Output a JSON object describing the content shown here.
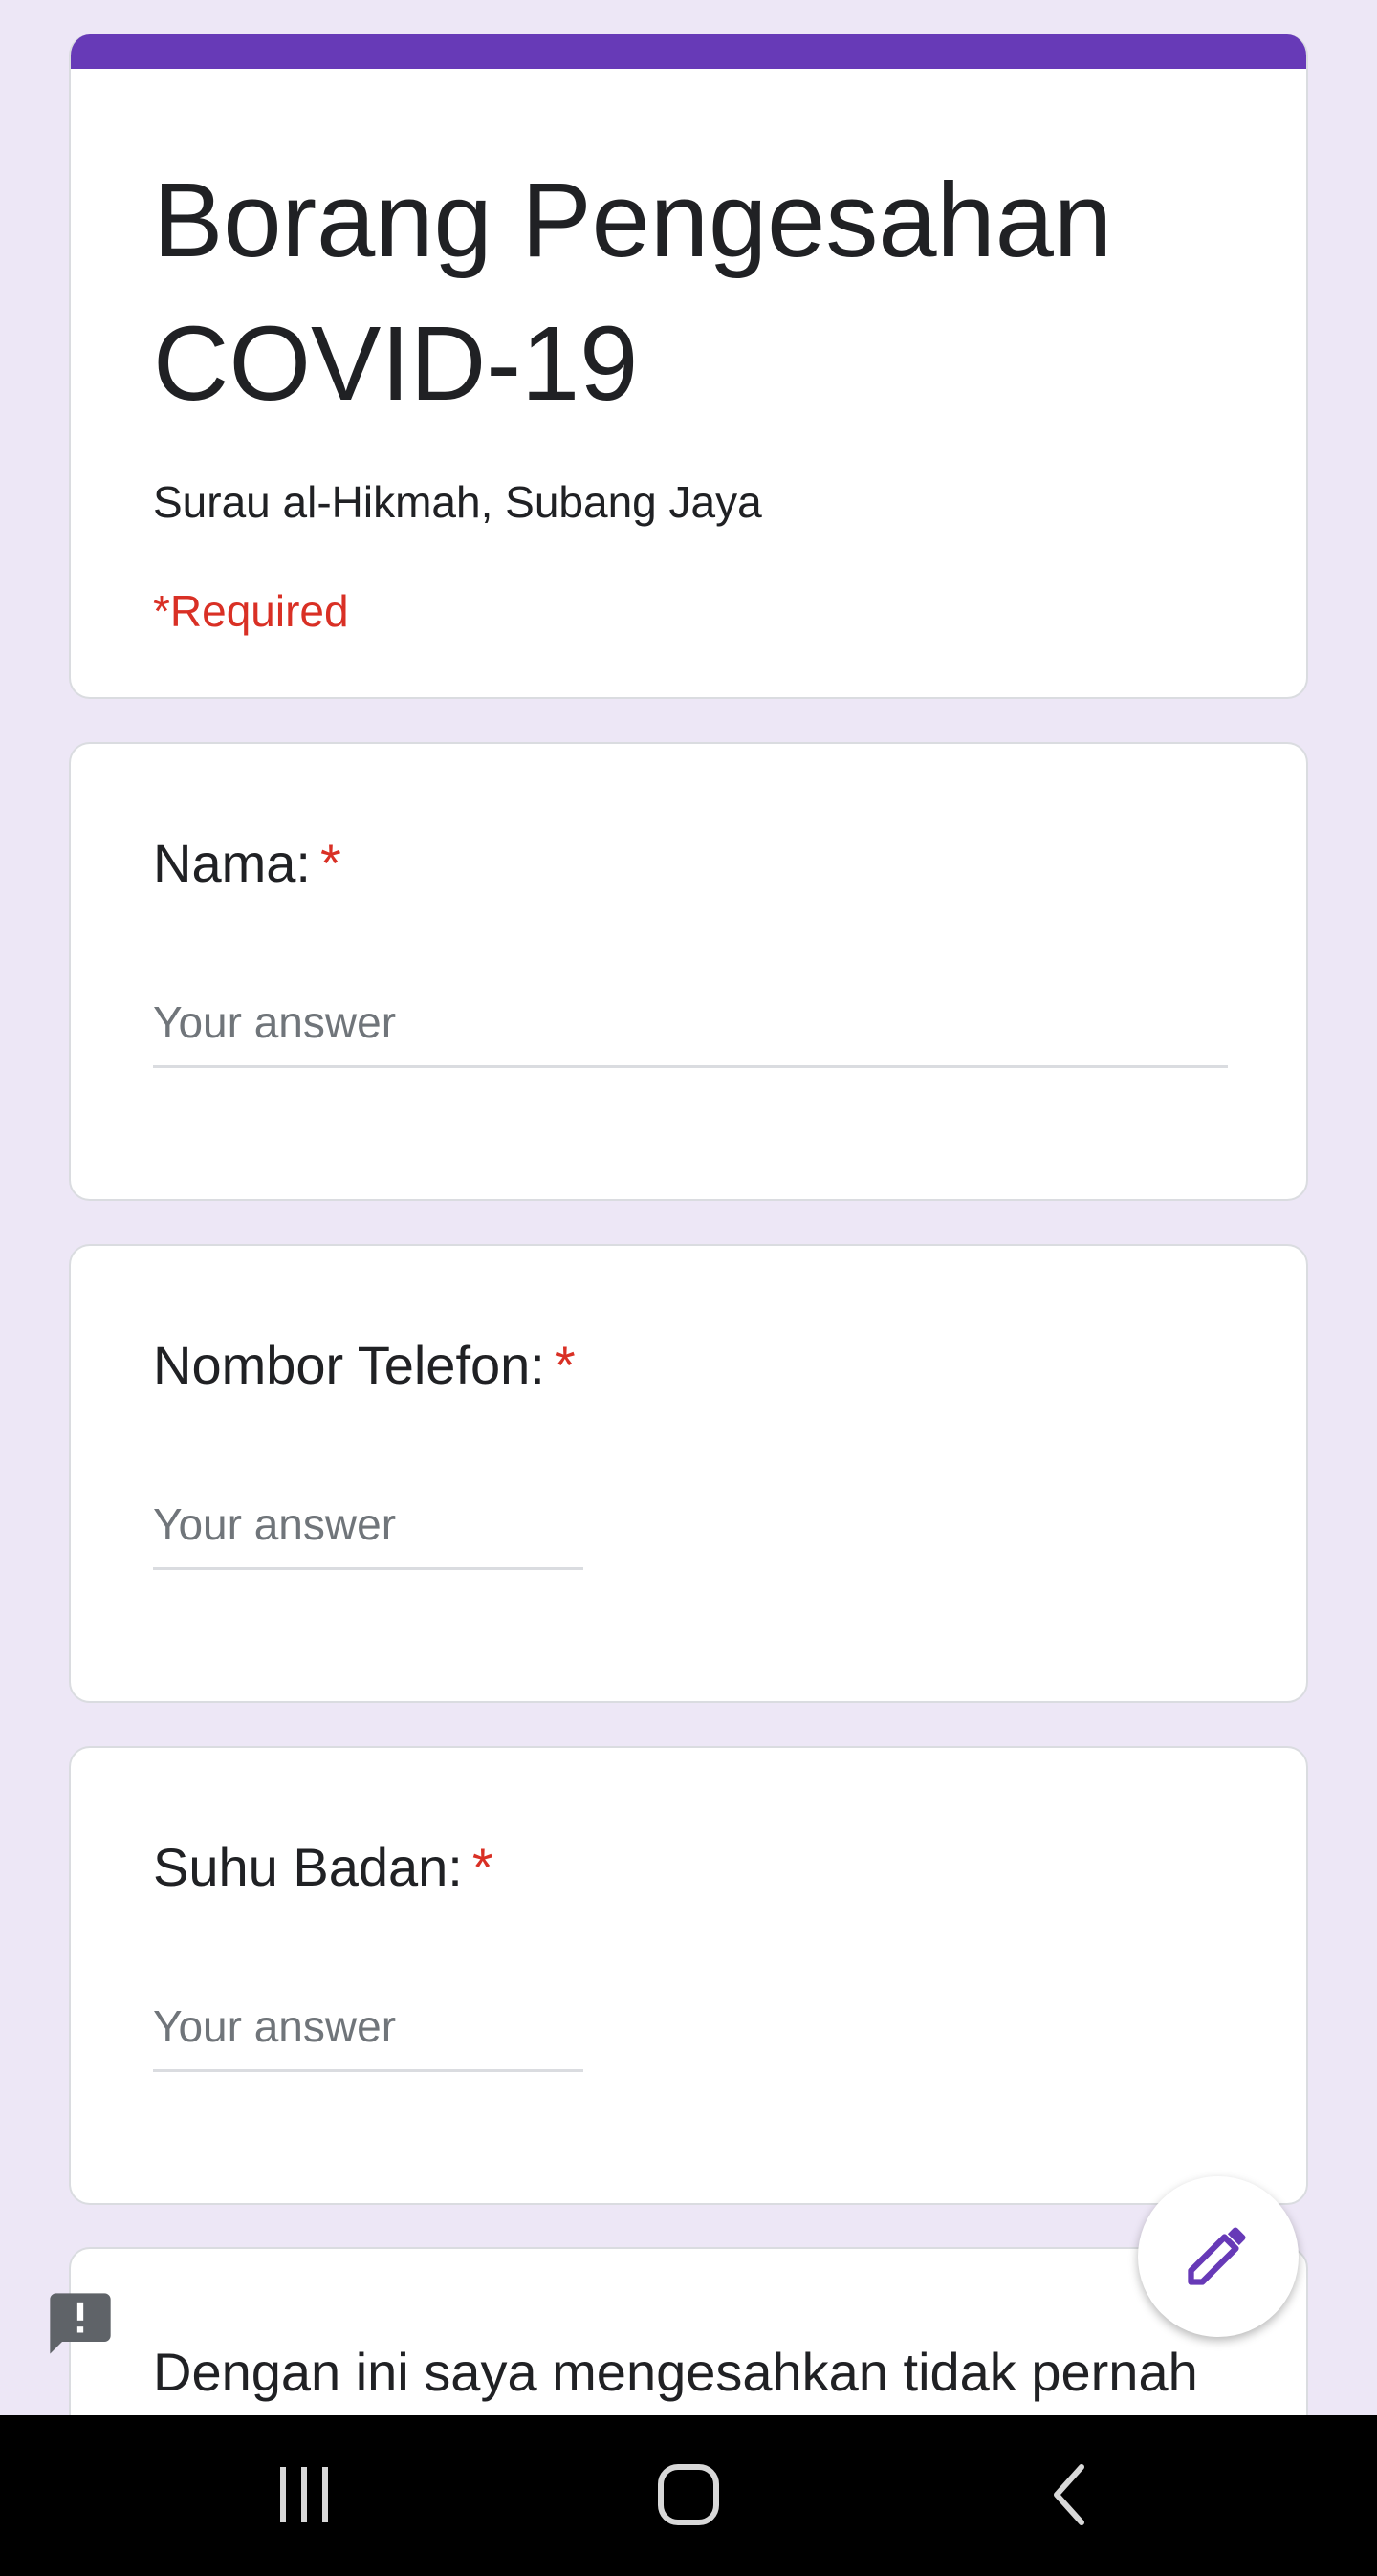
{
  "form": {
    "title": "Borang Pengesahan COVID-19",
    "description": "Surau al-Hikmah, Subang Jaya",
    "required_note": "*Required",
    "accent_color": "#673ab7",
    "background_color": "#ede7f6"
  },
  "questions": [
    {
      "label": "Nama:",
      "required_mark": "*",
      "placeholder": "Your answer"
    },
    {
      "label": "Nombor Telefon:",
      "required_mark": "*",
      "placeholder": "Your answer"
    },
    {
      "label": "Suhu Badan:",
      "required_mark": "*",
      "placeholder": "Your answer"
    }
  ],
  "partial_question": {
    "text": "Dengan ini saya mengesahkan tidak pernah"
  },
  "fab": {
    "icon": "pencil-icon"
  },
  "report": {
    "icon": "report-problem-icon"
  },
  "navbar": {
    "recents": {
      "icon": "recents-icon"
    },
    "home": {
      "icon": "home-icon"
    },
    "back": {
      "icon": "back-icon"
    }
  }
}
